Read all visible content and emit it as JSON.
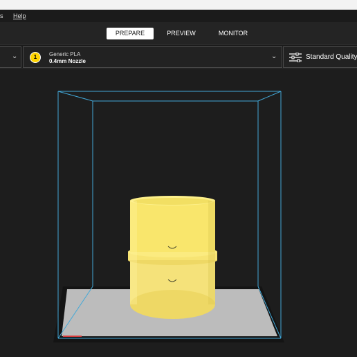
{
  "menu": {
    "item_partial": "s",
    "help": "Help"
  },
  "stages": {
    "prepare": "PREPARE",
    "preview": "PREVIEW",
    "monitor": "MONITOR"
  },
  "extruder": {
    "number": "1",
    "material": "Generic PLA",
    "nozzle": "0.4mm Nozzle",
    "color": "#ffd400"
  },
  "print_settings": {
    "quality": "Standard Quality..."
  },
  "colors": {
    "build_volume": "#42a8d8",
    "model": "#f9e66c",
    "plate": "#bcbcbc",
    "background": "#1d1d1d"
  },
  "icons": [
    "chevron-down-icon",
    "extruder-icon",
    "settings-sliders-icon",
    "chevron-down-icon"
  ]
}
